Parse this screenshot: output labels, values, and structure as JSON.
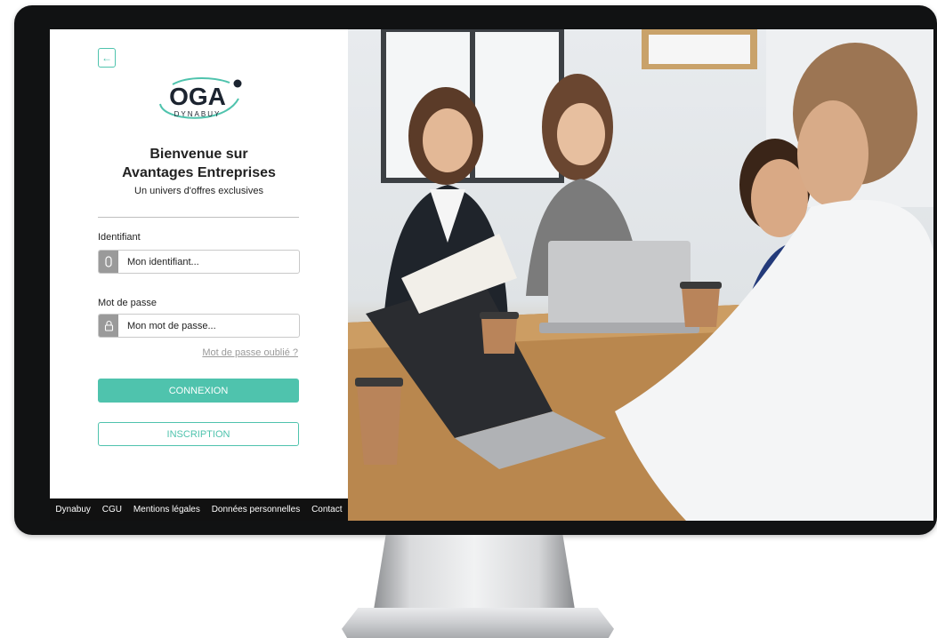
{
  "login": {
    "back_icon": "arrow-left-icon",
    "logo_main": "OGA",
    "logo_sub": "DYNABUY",
    "title_line1": "Bienvenue sur",
    "title_line2": "Avantages Entreprises",
    "subtitle": "Un univers d'offres exclusives",
    "identifiant_label": "Identifiant",
    "identifiant_placeholder": "Mon identifiant...",
    "identifiant_value": "",
    "password_label": "Mot de passe",
    "password_placeholder": "Mon mot de passe...",
    "password_value": "",
    "forgot_link": "Mot de passe oublié ?",
    "connexion_button": "CONNEXION",
    "inscription_button": "INSCRIPTION",
    "user_icon": "user-icon",
    "lock_icon": "lock-icon"
  },
  "footer": {
    "links": [
      "Dynabuy",
      "CGU",
      "Mentions légales",
      "Données personnelles",
      "Contact"
    ]
  },
  "colors": {
    "accent": "#4fc3ad",
    "footer_bg": "#111111",
    "logo_dark": "#1c2430"
  }
}
